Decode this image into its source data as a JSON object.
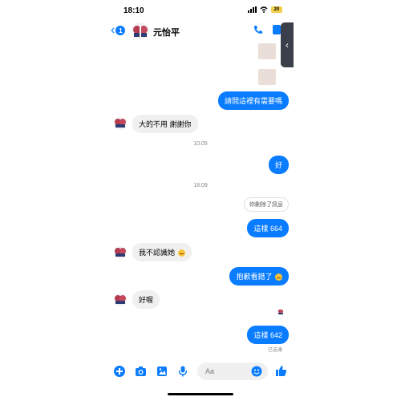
{
  "status": {
    "time": "18:10",
    "battery": "20"
  },
  "header": {
    "back_count": "1",
    "contact_name": "元怡平"
  },
  "messages": {
    "m1": "請問這裡有需要嗎",
    "m2": "大的不用 謝謝你",
    "t1": "10:05",
    "m3": "好",
    "t2": "18:09",
    "unsent": "你刪除了訊息",
    "m4": "這樣 664",
    "m5": "我不認識她",
    "m6": "抱歉看錯了",
    "m7": "好喔",
    "m8": "這樣 642",
    "sent": "已送達"
  },
  "composer": {
    "placeholder": "Aa"
  },
  "colors": {
    "accent": "#0a7cff",
    "incoming_bubble": "#f0f0f0"
  }
}
